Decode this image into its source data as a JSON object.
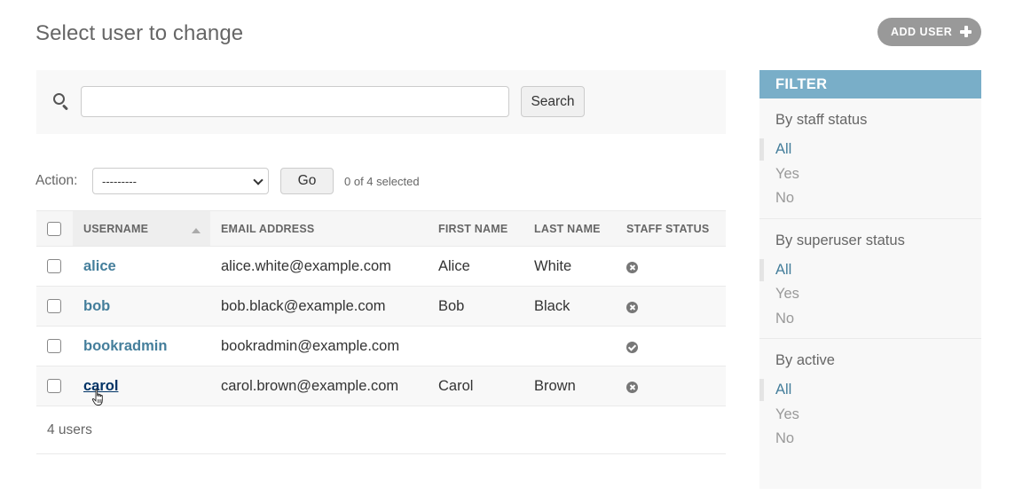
{
  "page": {
    "title": "Select user to change",
    "add_user_label": "ADD USER"
  },
  "search": {
    "value": "",
    "placeholder": "",
    "button_label": "Search"
  },
  "actions": {
    "label": "Action:",
    "selected_option": "---------",
    "go_label": "Go",
    "selected_count": "0 of 4 selected"
  },
  "table": {
    "columns": [
      "USERNAME",
      "EMAIL ADDRESS",
      "FIRST NAME",
      "LAST NAME",
      "STAFF STATUS"
    ],
    "rows": [
      {
        "username": "alice",
        "email": "alice.white@example.com",
        "first_name": "Alice",
        "last_name": "White",
        "staff_status": "no-icon"
      },
      {
        "username": "bob",
        "email": "bob.black@example.com",
        "first_name": "Bob",
        "last_name": "Black",
        "staff_status": "no-icon"
      },
      {
        "username": "bookradmin",
        "email": "bookradmin@example.com",
        "first_name": "",
        "last_name": "",
        "staff_status": "yes-icon"
      },
      {
        "username": "carol",
        "email": "carol.brown@example.com",
        "first_name": "Carol",
        "last_name": "Brown",
        "staff_status": "no-icon"
      }
    ],
    "footer": "4 users"
  },
  "filter": {
    "header": "FILTER",
    "groups": [
      {
        "title": "By staff status",
        "options": [
          "All",
          "Yes",
          "No"
        ],
        "selected": "All"
      },
      {
        "title": "By superuser status",
        "options": [
          "All",
          "Yes",
          "No"
        ],
        "selected": "All"
      },
      {
        "title": "By active",
        "options": [
          "All",
          "Yes",
          "No"
        ],
        "selected": "All"
      }
    ]
  },
  "colors": {
    "accent": "#79aec8",
    "link": "#447e9b",
    "add_button": "#999999"
  }
}
